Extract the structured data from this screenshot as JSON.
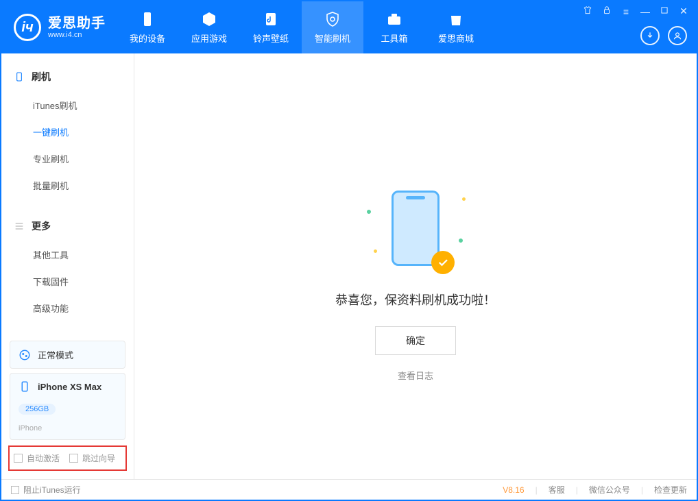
{
  "app": {
    "name_cn": "爱思助手",
    "name_en": "www.i4.cn"
  },
  "nav": {
    "items": [
      {
        "label": "我的设备"
      },
      {
        "label": "应用游戏"
      },
      {
        "label": "铃声壁纸"
      },
      {
        "label": "智能刷机"
      },
      {
        "label": "工具箱"
      },
      {
        "label": "爱思商城"
      }
    ],
    "active_index": 3
  },
  "sidebar": {
    "sections": [
      {
        "title": "刷机",
        "items": [
          {
            "label": "iTunes刷机"
          },
          {
            "label": "一键刷机"
          },
          {
            "label": "专业刷机"
          },
          {
            "label": "批量刷机"
          }
        ],
        "active_index": 1
      },
      {
        "title": "更多",
        "items": [
          {
            "label": "其他工具"
          },
          {
            "label": "下载固件"
          },
          {
            "label": "高级功能"
          }
        ],
        "active_index": -1
      }
    ]
  },
  "mode_card": {
    "label": "正常模式"
  },
  "device_card": {
    "name": "iPhone XS Max",
    "storage": "256GB",
    "subtype": "iPhone"
  },
  "bottom_checks": {
    "auto_activate": {
      "label": "自动激活",
      "checked": false
    },
    "skip_guide": {
      "label": "跳过向导",
      "checked": false
    }
  },
  "main": {
    "message": "恭喜您，保资料刷机成功啦！",
    "confirm": "确定",
    "view_log": "查看日志"
  },
  "statusbar": {
    "stop_itunes": {
      "label": "阻止iTunes运行",
      "checked": false
    },
    "version": "V8.16",
    "links": {
      "support": "客服",
      "wechat": "微信公众号",
      "update": "检查更新"
    }
  }
}
